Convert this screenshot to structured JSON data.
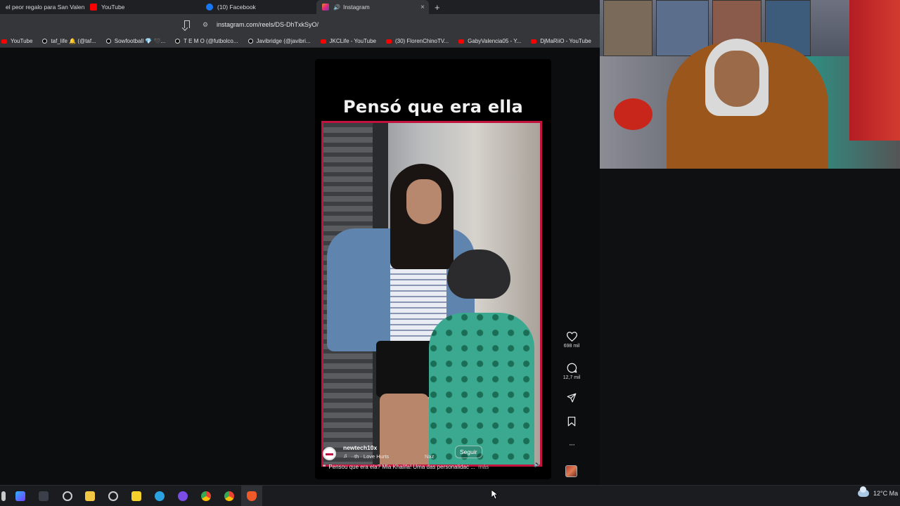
{
  "browser": {
    "tabs": [
      {
        "label": "el peor regalo para San Valen",
        "favicon_color": "#ff0000"
      },
      {
        "label": "YouTube",
        "favicon_color": "#ff0000"
      },
      {
        "label": "(10) Facebook",
        "favicon_color": "#1877f2"
      },
      {
        "label": "Instagram",
        "favicon_color": "#e1306c",
        "active": true
      }
    ],
    "new_tab_symbol": "+",
    "close_symbol": "×",
    "url": "instagram.com/reels/DS-DhTxkSyO/",
    "bookmarks": [
      {
        "label": "YouTube",
        "icon": "youtube-icon"
      },
      {
        "label": "taf_life 🔔 (@taf...",
        "icon": "tiktok-icon"
      },
      {
        "label": "Sowfootball 💎 🖤...",
        "icon": "tiktok-icon"
      },
      {
        "label": "T E M O (@futbolco...",
        "icon": "tiktok-icon"
      },
      {
        "label": "Javibridge (@javibri...",
        "icon": "tiktok-icon"
      },
      {
        "label": "JKCLife - YouTube",
        "icon": "youtube-icon"
      },
      {
        "label": "(30) FlorenChinoTV...",
        "icon": "youtube-icon"
      },
      {
        "label": "GabyValencia05 - Y...",
        "icon": "youtube-icon"
      },
      {
        "label": "DjMaRiiO - YouTube",
        "icon": "youtube-icon"
      }
    ]
  },
  "reel": {
    "title": "Pensó que era ella",
    "username": "newtech10x",
    "audio": "··th · Love Hurts",
    "audio_extra": "Naz",
    "follow_label": "Seguir",
    "caption_quote": "❝",
    "caption": "Pensou que era ela? Mia Khalifa! Uma das personalidac ...",
    "caption_more": "más",
    "accent_color": "#c2133d"
  },
  "actions": {
    "likes": "698 mil",
    "comments": "12,7 mil",
    "more_symbol": "···"
  },
  "taskbar": {
    "weather": "12°C",
    "weather_extra": "Ma"
  }
}
